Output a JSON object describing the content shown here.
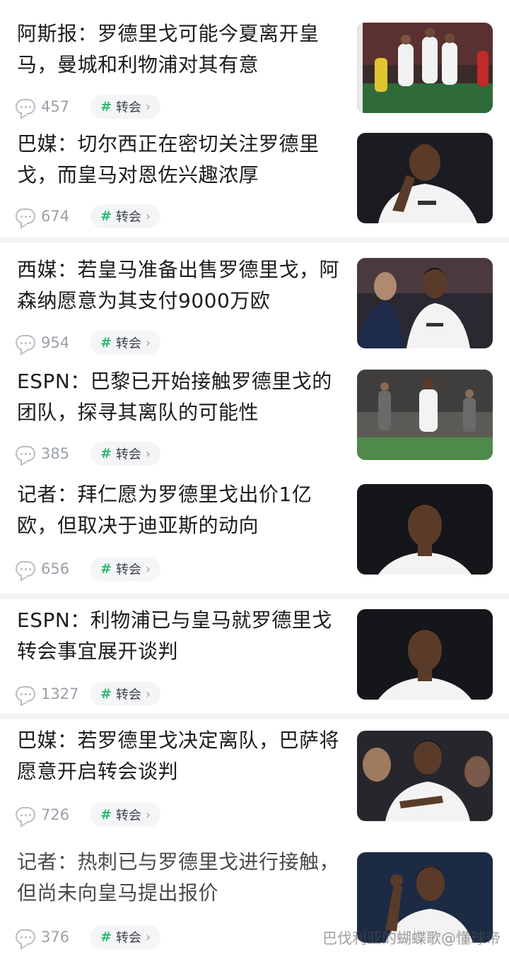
{
  "articles": [
    {
      "title": "阿斯报：罗德里戈可能今夏离开皇马，曼城和利物浦对其有意",
      "comments": "457",
      "tag": "转会"
    },
    {
      "title": "巴媒：切尔西正在密切关注罗德里戈，而皇马对恩佐兴趣浓厚",
      "comments": "674",
      "tag": "转会"
    },
    {
      "title": "西媒：若皇马准备出售罗德里戈，阿森纳愿意为其支付9000万欧",
      "comments": "954",
      "tag": "转会"
    },
    {
      "title": "ESPN：巴黎已开始接触罗德里戈的团队，探寻其离队的可能性",
      "comments": "385",
      "tag": "转会"
    },
    {
      "title": "记者：拜仁愿为罗德里戈出价1亿欧，但取决于迪亚斯的动向",
      "comments": "656",
      "tag": "转会"
    },
    {
      "title": "ESPN：利物浦已与皇马就罗德里戈转会事宜展开谈判",
      "comments": "1327",
      "tag": "转会"
    },
    {
      "title": "巴媒：若罗德里戈决定离队，巴萨将愿意开启转会谈判",
      "comments": "726",
      "tag": "转会"
    },
    {
      "title": "记者：热刺已与罗德里戈进行接触，但尚未向皇马提出报价",
      "comments": "376",
      "tag": "转会"
    }
  ],
  "watermark": "巴伐利亚的蝴蝶歌@懂球帝",
  "icons": {
    "comment": "comment-bubble-icon",
    "tag": "hash-icon",
    "chevron": "chevron-right-icon"
  },
  "colors": {
    "accent": "#2eb872",
    "muted": "#9aa0a8",
    "divider": "#f2f3f5"
  }
}
